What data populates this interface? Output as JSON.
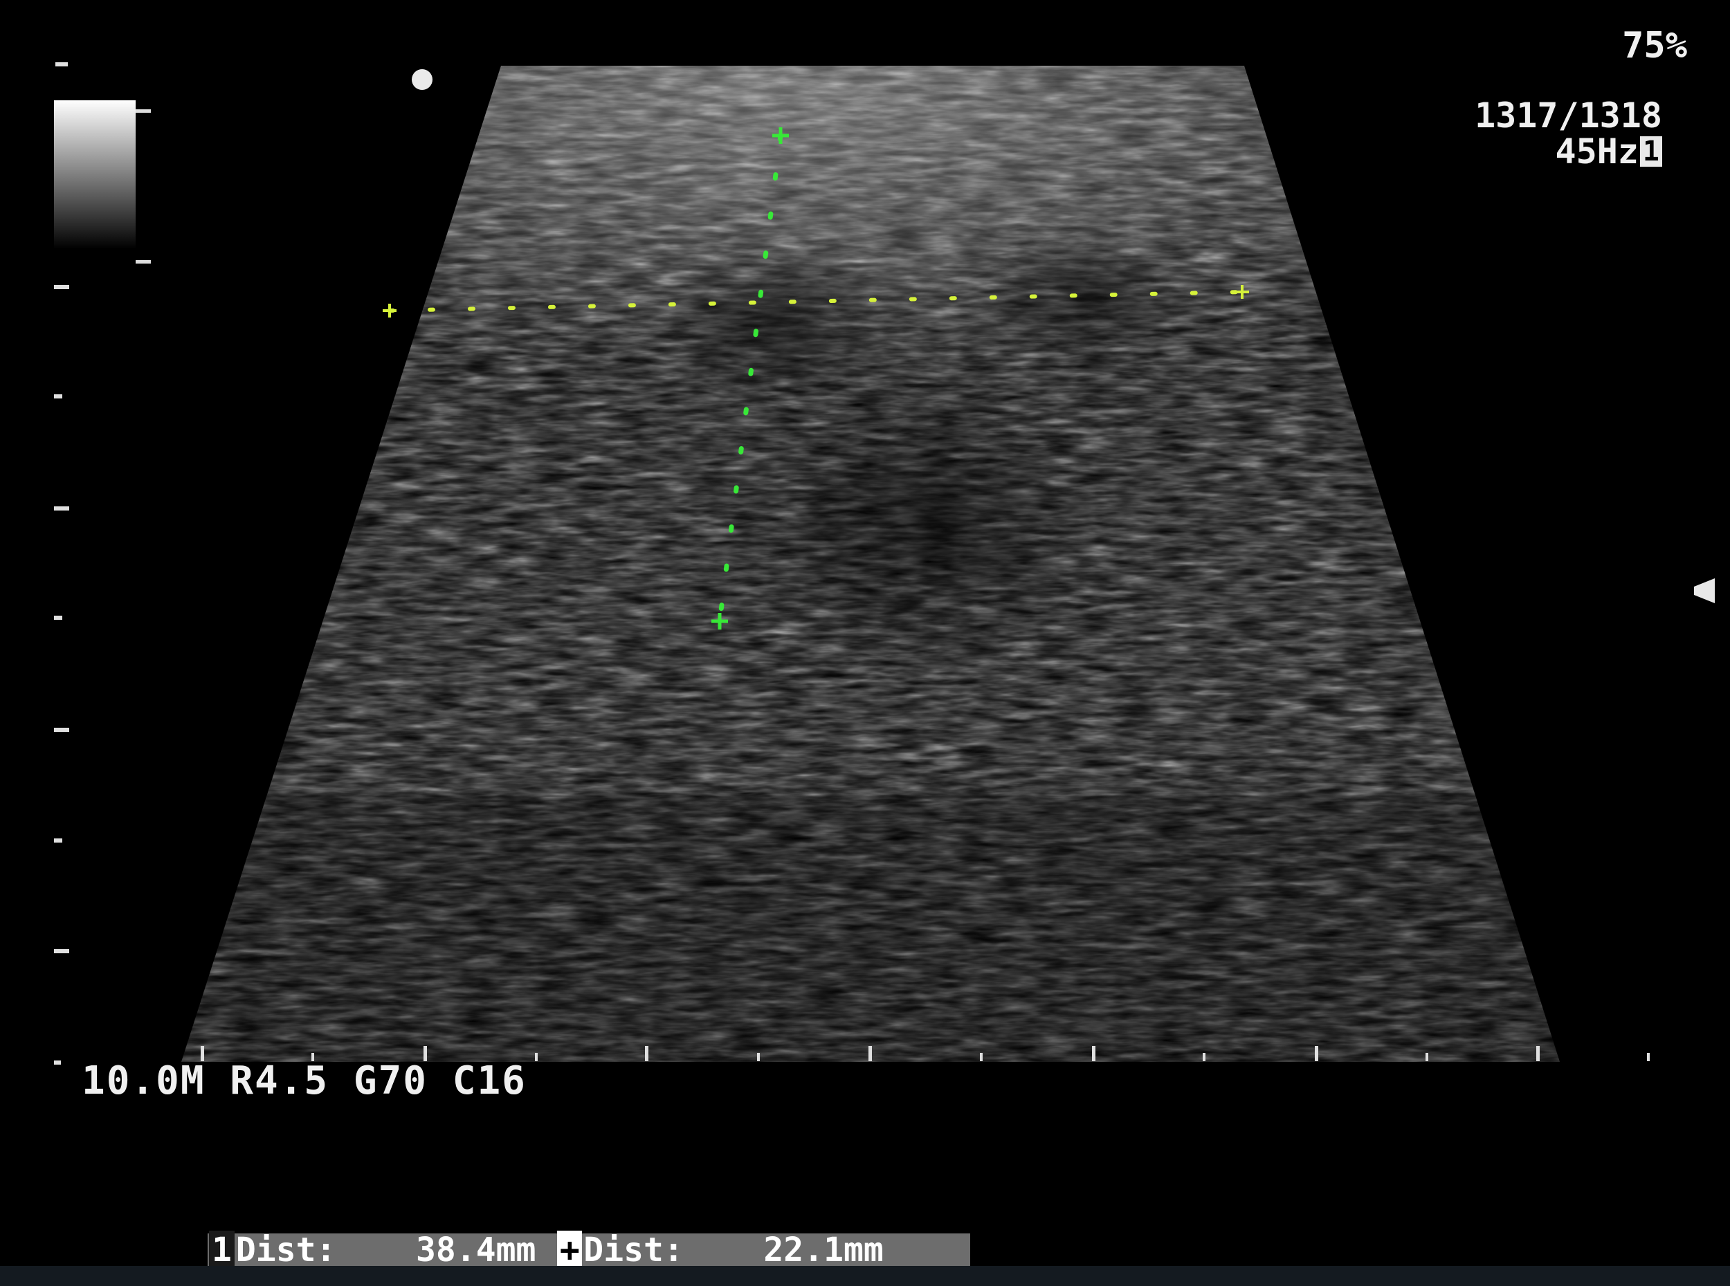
{
  "overlay": {
    "zoom": "75%",
    "frame": "1317/1318",
    "frame_rate": "45Hz",
    "frame_rate_badge": "1",
    "params": "10.0M R4.5 G70 C16"
  },
  "measurements": {
    "m1_marker": "1",
    "m1_label": "Dist:",
    "m1_value": "38.4mm",
    "m2_marker": "+",
    "m2_label": "Dist:",
    "m2_value": "22.1mm"
  },
  "colors": {
    "background": "#000000",
    "caliper_1": "#d6f23a",
    "caliper_2": "#38e838",
    "text": "#f0f0f0"
  },
  "icons": [
    "focus-dot-icon",
    "depth-pointer-icon",
    "caliper-cross-icon"
  ]
}
